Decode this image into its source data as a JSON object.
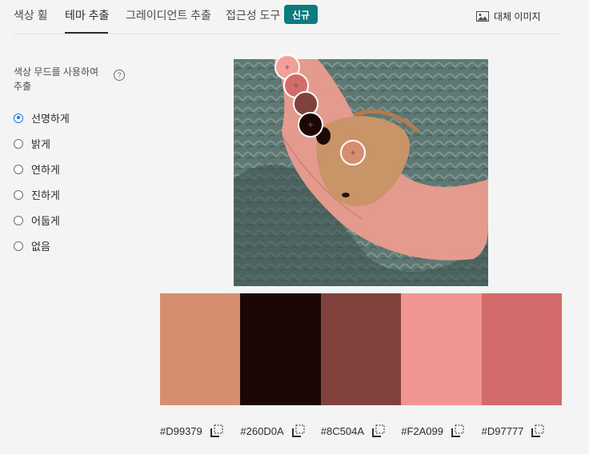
{
  "tabs": [
    {
      "label": "색상 휠"
    },
    {
      "label": "테마 추출"
    },
    {
      "label": "그레이디언트 추출"
    },
    {
      "label": "접근성 도구"
    }
  ],
  "new_badge": "신규",
  "alt_image_label": "대체 이미지",
  "mood": {
    "label": "색상 무드를 사용하여 추출",
    "selected": "선명하게",
    "options": [
      "선명하게",
      "밝게",
      "연하게",
      "진하게",
      "어둡게",
      "없음"
    ]
  },
  "swatches": [
    {
      "hex": "#D99379",
      "color": "#d68d70"
    },
    {
      "hex": "#260D0A",
      "color": "#1d0705"
    },
    {
      "hex": "#8C504A",
      "color": "#80423c"
    },
    {
      "hex": "#F2A099",
      "color": "#ee968f"
    },
    {
      "hex": "#D97777",
      "color": "#d46b6b"
    }
  ]
}
